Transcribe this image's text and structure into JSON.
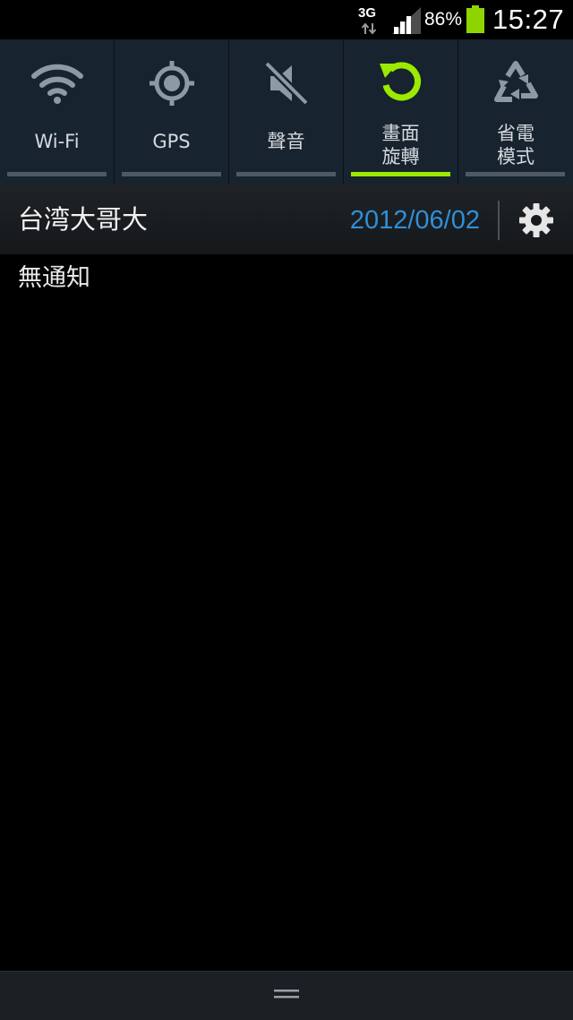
{
  "status_bar": {
    "network_type": "3G",
    "battery_percent": "86%",
    "battery_level": 0.86,
    "signal_level": 0.75,
    "time": "15:27"
  },
  "quick_settings": [
    {
      "id": "wifi",
      "label": "Wi-Fi",
      "icon": "wifi-icon",
      "active": false
    },
    {
      "id": "gps",
      "label": "GPS",
      "icon": "gps-icon",
      "active": false
    },
    {
      "id": "sound",
      "label": "聲音",
      "icon": "mute-icon",
      "active": false
    },
    {
      "id": "rotation",
      "label_line1": "畫面",
      "label_line2": "旋轉",
      "icon": "screen-rotation-icon",
      "active": true
    },
    {
      "id": "power_saving",
      "label_line1": "省電",
      "label_line2": "模式",
      "icon": "recycle-icon",
      "active": false
    }
  ],
  "info_bar": {
    "carrier": "台湾大哥大",
    "date": "2012/06/02",
    "settings_icon": "gear-icon"
  },
  "notifications": {
    "empty_message": "無通知"
  },
  "colors": {
    "active_accent": "#9bea00",
    "date_blue": "#2e8fd8",
    "battery_green": "#8fd400"
  }
}
